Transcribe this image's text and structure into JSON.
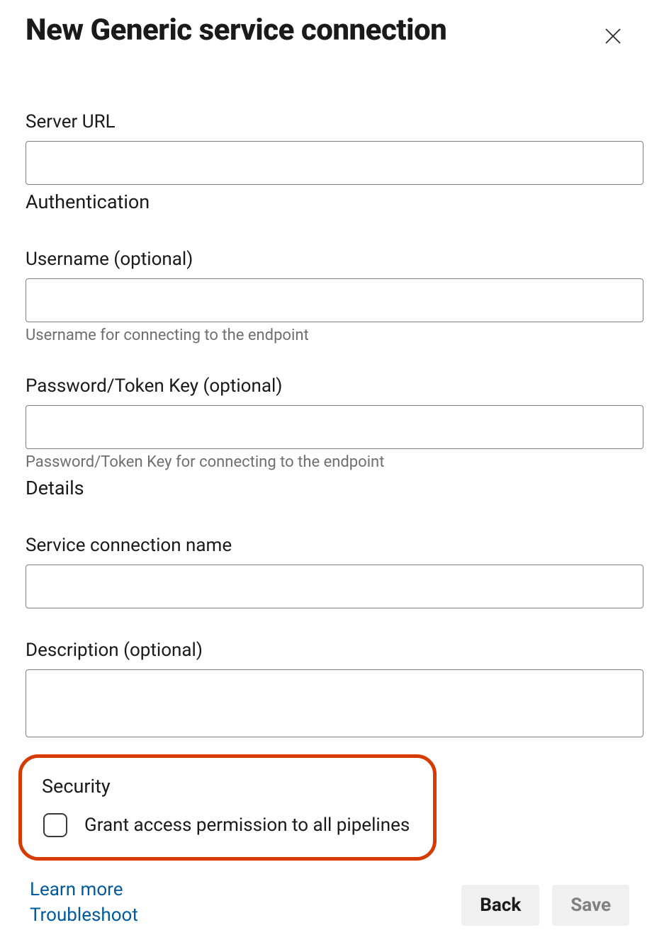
{
  "header": {
    "title": "New Generic service connection"
  },
  "fields": {
    "server_url": {
      "label": "Server URL",
      "value": ""
    },
    "authentication_heading": "Authentication",
    "username": {
      "label": "Username (optional)",
      "value": "",
      "help": "Username for connecting to the endpoint"
    },
    "password": {
      "label": "Password/Token Key (optional)",
      "value": "",
      "help": "Password/Token Key for connecting to the endpoint"
    },
    "details_heading": "Details",
    "service_name": {
      "label": "Service connection name",
      "value": ""
    },
    "description": {
      "label": "Description (optional)",
      "value": ""
    }
  },
  "security": {
    "heading": "Security",
    "checkbox_label": "Grant access permission to all pipelines",
    "checked": false
  },
  "footer": {
    "learn_more": "Learn more",
    "troubleshoot": "Troubleshoot",
    "back": "Back",
    "save": "Save"
  }
}
